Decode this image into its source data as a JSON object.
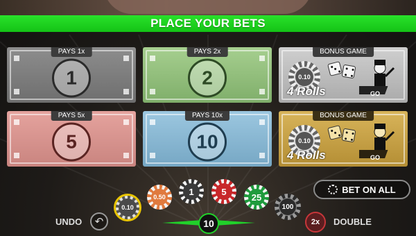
{
  "banner": {
    "title": "PLACE YOUR BETS"
  },
  "bets": [
    {
      "id": "1",
      "tab": "PAYS 1x",
      "number": "1"
    },
    {
      "id": "2",
      "tab": "PAYS 2x",
      "number": "2"
    },
    {
      "id": "5",
      "tab": "PAYS 5x",
      "number": "5"
    },
    {
      "id": "10",
      "tab": "PAYS 10x",
      "number": "10"
    }
  ],
  "bonus": [
    {
      "tab": "BONUS GAME",
      "chip": "0.10",
      "label": "4 Rolls",
      "go": "GO"
    },
    {
      "tab": "BONUS GAME",
      "chip": "0.10",
      "label": "4 Rolls",
      "go": "GO"
    }
  ],
  "chips": [
    {
      "value": "0.10",
      "color": "#4a4a4a",
      "selected": true
    },
    {
      "value": "0.50",
      "color": "#e07a3e"
    },
    {
      "value": "1",
      "color": "#3a3a3a"
    },
    {
      "value": "5",
      "color": "#c8282b"
    },
    {
      "value": "25",
      "color": "#1f9b3d"
    },
    {
      "value": "100",
      "color": "#2b2b2b"
    }
  ],
  "controls": {
    "undo_label": "UNDO",
    "undo_icon": "↶",
    "double_label": "DOUBLE",
    "double_icon": "2x",
    "bet_all_label": "BET ON ALL",
    "total_bet": "10"
  },
  "colors": {
    "accent": "#21d12a",
    "selected_ring": "#e8c400"
  }
}
